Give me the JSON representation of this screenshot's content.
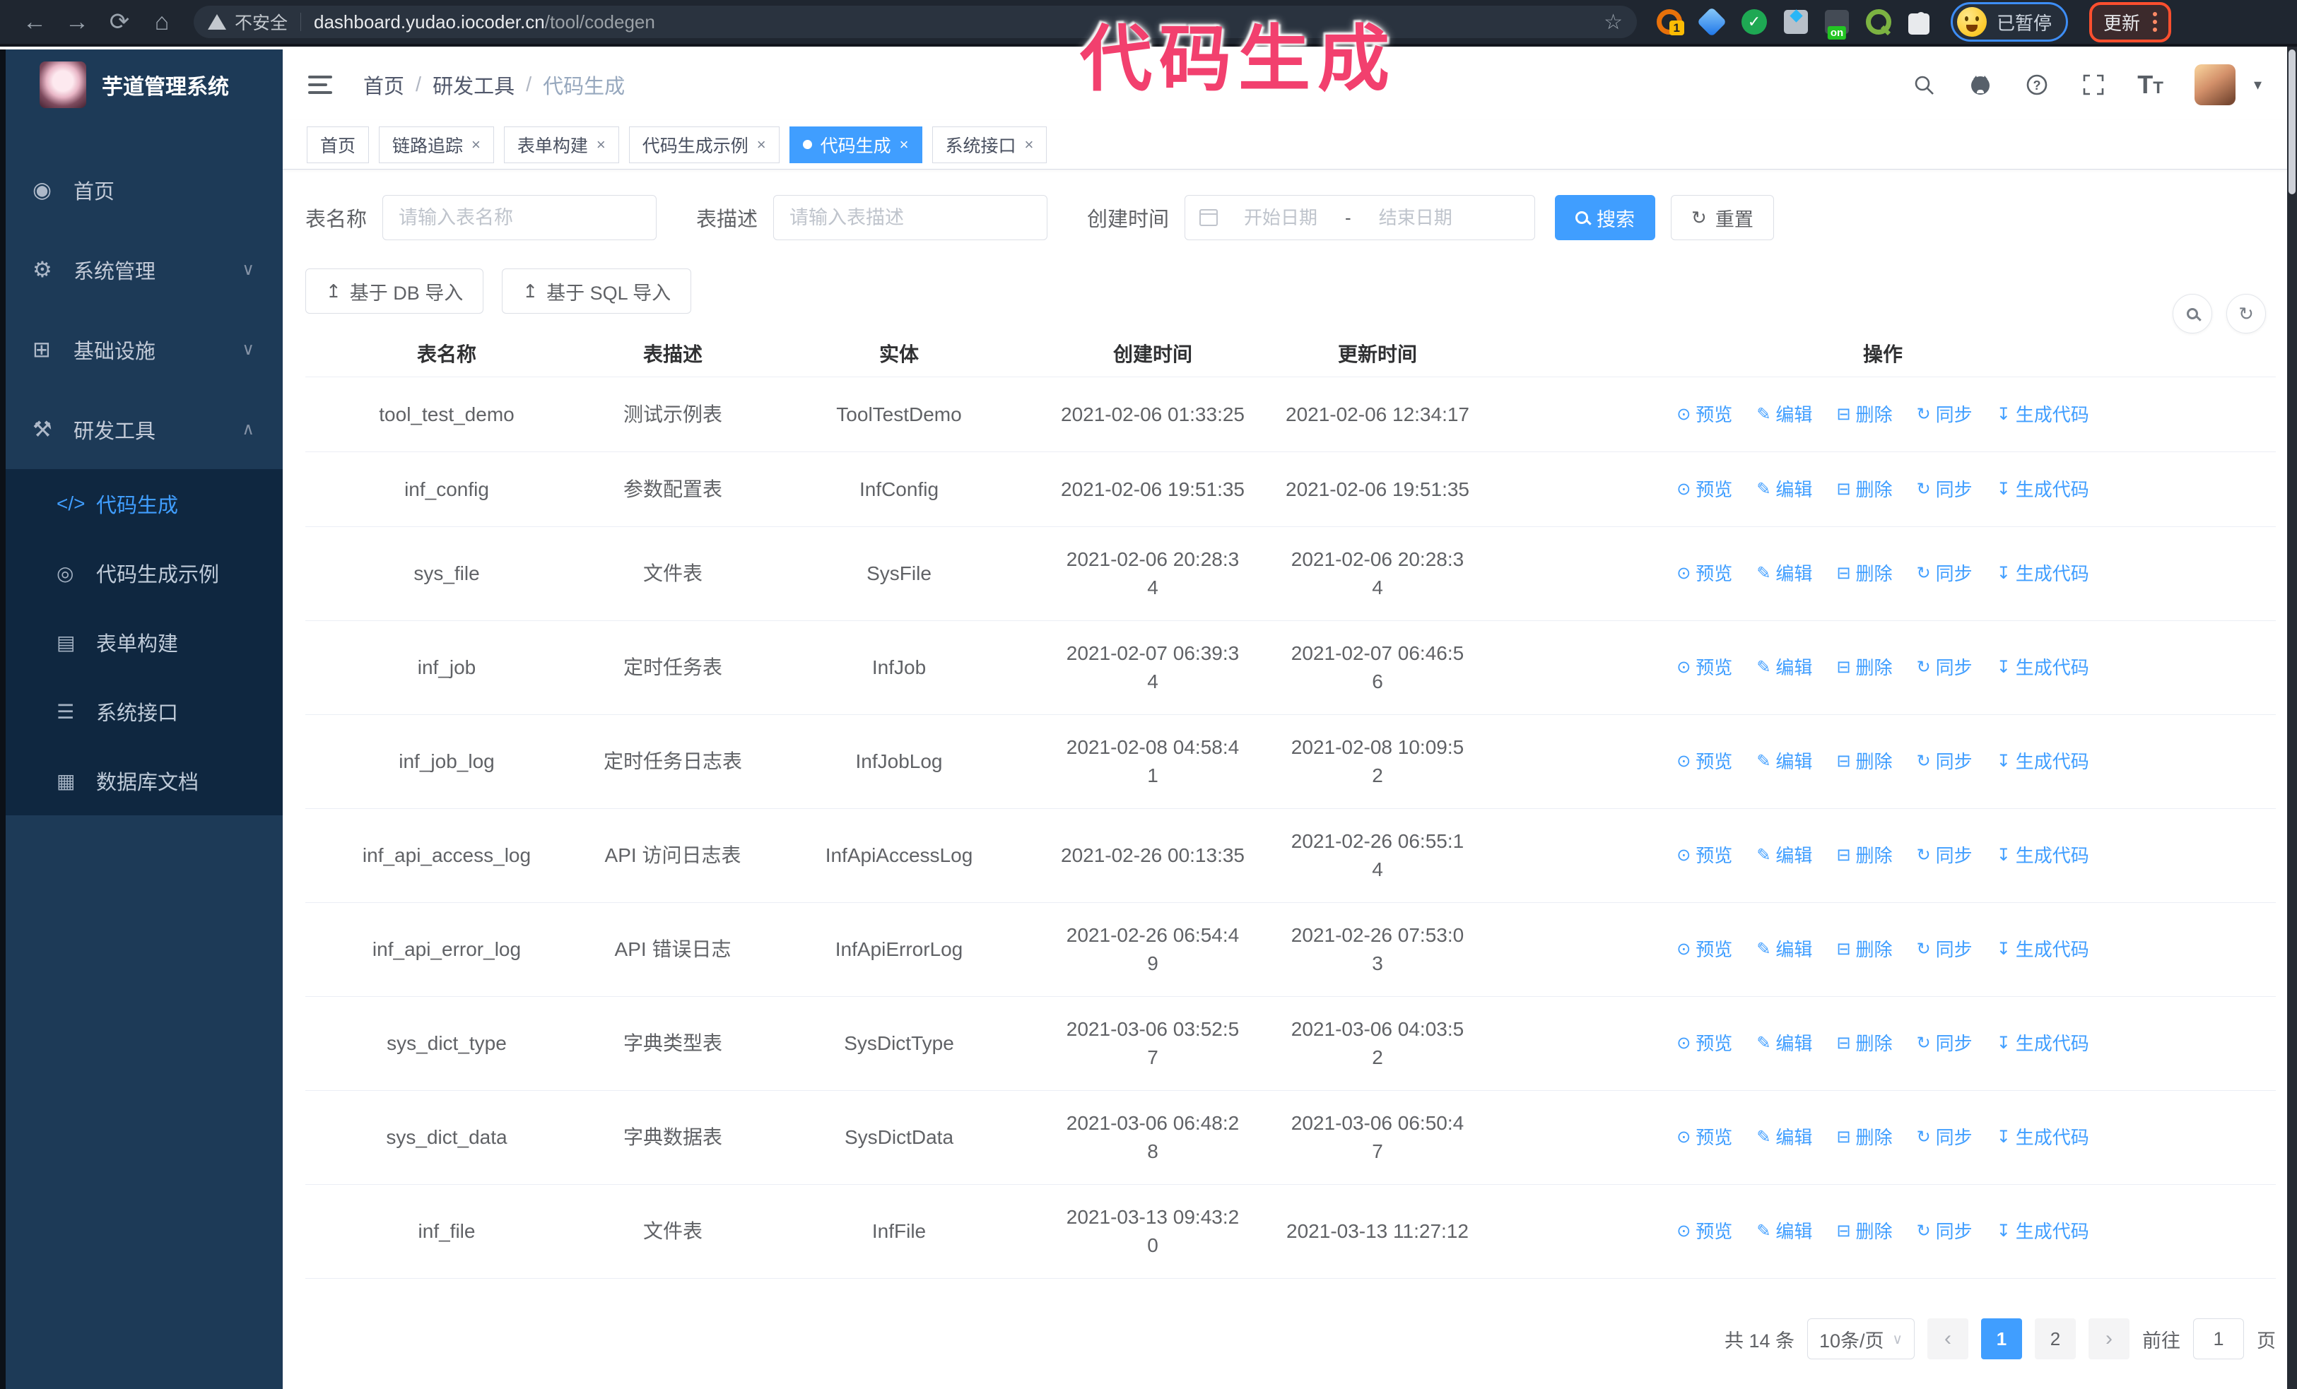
{
  "browser": {
    "security_label": "不安全",
    "url_domain": "dashboard.yudao.iocoder.cn",
    "url_path": "/tool/codegen",
    "extension_badge_count": "1",
    "extension_on_badge": "on",
    "paused_badge": "已暂停",
    "update_button": "更新"
  },
  "annotation": {
    "text": "代码生成",
    "color": "#f2406e"
  },
  "sidebar": {
    "logo_title": "芋道管理系统",
    "items": [
      {
        "label": "首页",
        "icon": "◉",
        "chevron": ""
      },
      {
        "label": "系统管理",
        "icon": "⚙",
        "chevron": "∨"
      },
      {
        "label": "基础设施",
        "icon": "⊞",
        "chevron": "∨"
      },
      {
        "label": "研发工具",
        "icon": "⚒",
        "chevron": "∧"
      }
    ],
    "submenu": [
      {
        "label": "代码生成",
        "icon": "</>"
      },
      {
        "label": "代码生成示例",
        "icon": "◎"
      },
      {
        "label": "表单构建",
        "icon": "▤"
      },
      {
        "label": "系统接口",
        "icon": "☰"
      },
      {
        "label": "数据库文档",
        "icon": "▦"
      }
    ]
  },
  "header": {
    "breadcrumb": [
      "首页",
      "研发工具",
      "代码生成"
    ]
  },
  "tabs": [
    {
      "label": "首页"
    },
    {
      "label": "链路追踪"
    },
    {
      "label": "表单构建"
    },
    {
      "label": "代码生成示例"
    },
    {
      "label": "代码生成"
    },
    {
      "label": "系统接口"
    }
  ],
  "search": {
    "name_label": "表名称",
    "name_placeholder": "请输入表名称",
    "desc_label": "表描述",
    "desc_placeholder": "请输入表描述",
    "time_label": "创建时间",
    "start_placeholder": "开始日期",
    "range_separator": "-",
    "end_placeholder": "结束日期",
    "search_button": "搜索",
    "reset_button": "重置"
  },
  "toolbar": {
    "import_db": "基于 DB 导入",
    "import_sql": "基于 SQL 导入",
    "upload_icon": "↥",
    "reset_icon": "↻"
  },
  "table": {
    "columns": [
      "表名称",
      "表描述",
      "实体",
      "创建时间",
      "更新时间",
      "操作"
    ],
    "actions": [
      {
        "key": "preview",
        "icon": "⊙",
        "label": "预览"
      },
      {
        "key": "edit",
        "icon": "✎",
        "label": "编辑"
      },
      {
        "key": "delete",
        "icon": "⊟",
        "label": "删除"
      },
      {
        "key": "sync",
        "icon": "↻",
        "label": "同步"
      },
      {
        "key": "generate",
        "icon": "↧",
        "label": "生成代码"
      }
    ],
    "rows": [
      {
        "name": "tool_test_demo",
        "desc": "测试示例表",
        "entity": "ToolTestDemo",
        "create": "2021-02-06 01:33:25",
        "update": "2021-02-06 12:34:17"
      },
      {
        "name": "inf_config",
        "desc": "参数配置表",
        "entity": "InfConfig",
        "create": "2021-02-06 19:51:35",
        "update": "2021-02-06 19:51:35"
      },
      {
        "name": "sys_file",
        "desc": "文件表",
        "entity": "SysFile",
        "create": "2021-02-06 20:28:3\n4",
        "update": "2021-02-06 20:28:3\n4"
      },
      {
        "name": "inf_job",
        "desc": "定时任务表",
        "entity": "InfJob",
        "create": "2021-02-07 06:39:3\n4",
        "update": "2021-02-07 06:46:5\n6"
      },
      {
        "name": "inf_job_log",
        "desc": "定时任务日志表",
        "entity": "InfJobLog",
        "create": "2021-02-08 04:58:4\n1",
        "update": "2021-02-08 10:09:5\n2"
      },
      {
        "name": "inf_api_access_log",
        "desc": "API 访问日志表",
        "entity": "InfApiAccessLog",
        "create": "2021-02-26 00:13:35",
        "update": "2021-02-26 06:55:1\n4"
      },
      {
        "name": "inf_api_error_log",
        "desc": "API 错误日志",
        "entity": "InfApiErrorLog",
        "create": "2021-02-26 06:54:4\n9",
        "update": "2021-02-26 07:53:0\n3"
      },
      {
        "name": "sys_dict_type",
        "desc": "字典类型表",
        "entity": "SysDictType",
        "create": "2021-03-06 03:52:5\n7",
        "update": "2021-03-06 04:03:5\n2"
      },
      {
        "name": "sys_dict_data",
        "desc": "字典数据表",
        "entity": "SysDictData",
        "create": "2021-03-06 06:48:2\n8",
        "update": "2021-03-06 06:50:4\n7"
      },
      {
        "name": "inf_file",
        "desc": "文件表",
        "entity": "InfFile",
        "create": "2021-03-13 09:43:2\n0",
        "update": "2021-03-13 11:27:12"
      }
    ]
  },
  "pagination": {
    "total_text": "共 14 条",
    "page_size": "10条/页",
    "pages": [
      "1",
      "2"
    ],
    "prev_icon": "‹",
    "next_icon": "›",
    "jump_prefix": "前往",
    "jump_value": "1",
    "jump_suffix": "页"
  },
  "icons": {
    "close": "×",
    "slash": "/",
    "caret_down": "▾",
    "select_caret": "∨"
  },
  "colors": {
    "accent": "#409eff",
    "sidebar_bg": "#1d3a57",
    "submenu_bg": "#0f2740",
    "annotation_pink": "#f2406e",
    "chrome_bg": "#1f2630"
  }
}
